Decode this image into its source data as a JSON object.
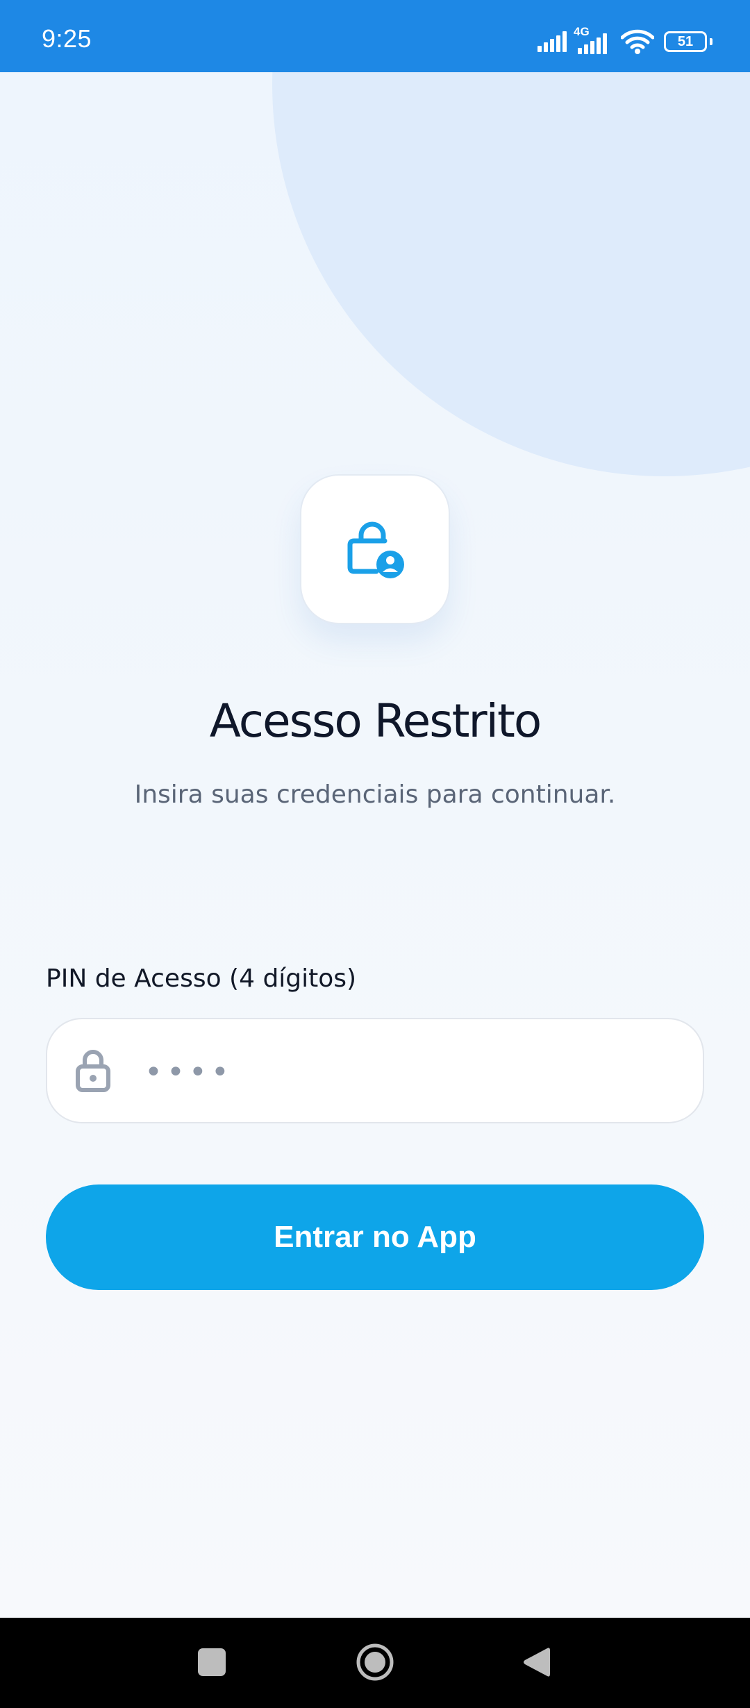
{
  "status_bar": {
    "time": "9:25",
    "network": "4G",
    "battery": "51",
    "icons": [
      "signal-icon",
      "signal-4g-icon",
      "wifi-icon",
      "battery-icon"
    ]
  },
  "logo": {
    "icon": "lock-user-icon"
  },
  "header": {
    "title": "Acesso Restrito",
    "subtitle": "Insira suas credenciais para continuar."
  },
  "form": {
    "pin_label": "PIN de Acesso (4 dígitos)",
    "pin_placeholder": "••••",
    "pin_value": "",
    "field_icon": "lock-icon",
    "submit_label": "Entrar no App"
  },
  "nav": {
    "icons": [
      "recent-apps-icon",
      "home-icon",
      "back-icon"
    ]
  },
  "colors": {
    "status_bar": "#1E88E5",
    "accent": "#0EA5E9",
    "title": "#0F172A",
    "background_circle": "#DEEBFB"
  }
}
